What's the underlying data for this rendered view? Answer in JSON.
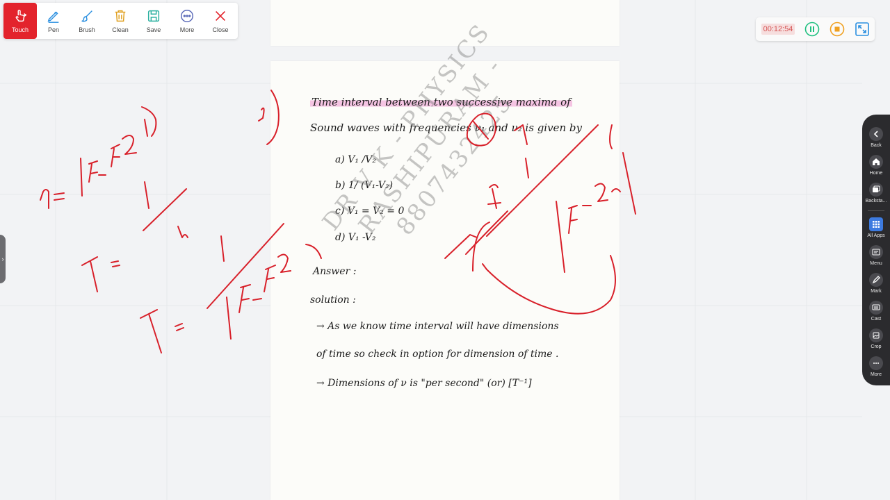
{
  "toolbar": {
    "tools": [
      {
        "label": "Touch",
        "icon": "touch-icon",
        "active": true
      },
      {
        "label": "Pen",
        "icon": "pen-icon"
      },
      {
        "label": "Brush",
        "icon": "brush-icon"
      },
      {
        "label": "Clean",
        "icon": "trash-icon"
      },
      {
        "label": "Save",
        "icon": "save-icon"
      },
      {
        "label": "More",
        "icon": "more-icon"
      },
      {
        "label": "Close",
        "icon": "close-icon"
      }
    ]
  },
  "recorder": {
    "time": "00:12:54",
    "pause_icon": "pause-icon",
    "stop_icon": "stop-icon",
    "fullscreen_icon": "fullscreen-icon"
  },
  "dock": {
    "items": [
      {
        "label": "Back",
        "icon": "back-icon"
      },
      {
        "label": "Home",
        "icon": "home-icon"
      },
      {
        "label": "Backsta...",
        "icon": "backstage-icon"
      },
      {
        "label": "All Apps",
        "icon": "all-apps-icon"
      },
      {
        "label": "Menu",
        "icon": "menu-icon"
      },
      {
        "label": "Mark",
        "icon": "mark-icon"
      },
      {
        "label": "Cast",
        "icon": "cast-icon"
      },
      {
        "label": "Crop",
        "icon": "crop-icon"
      },
      {
        "label": "More",
        "icon": "more-icon"
      }
    ]
  },
  "document": {
    "question_line1_hl": "Time interval between two successive maxima of",
    "question_line2_a": "Sound waves with frequencies ",
    "question_line2_b": "ν₁ and ν₂",
    "question_line2_c": " is given by",
    "options": [
      "a)  V₁ /V₂",
      "b)  1/ (V₁-V₂)",
      "c)  V₁ = V₂ = 0",
      "d)  V₁ -V₂"
    ],
    "answer_label": "Answer :",
    "solution_label": "solution :",
    "solution_line1": "→  As we know time interval will have dimensions",
    "solution_line2": "of time so check in option for dimension of time .",
    "solution_line3": "→  Dimensions of ν is \"per second\" (or) [T⁻¹]"
  },
  "watermark": {
    "line1": "DR  V  K - PHYSICS",
    "line2": "RASHIPURAM - 8807432425"
  },
  "colors": {
    "ink": "#d8202a",
    "highlight": "#ec80c8",
    "toolbar_active": "#e3232c"
  }
}
